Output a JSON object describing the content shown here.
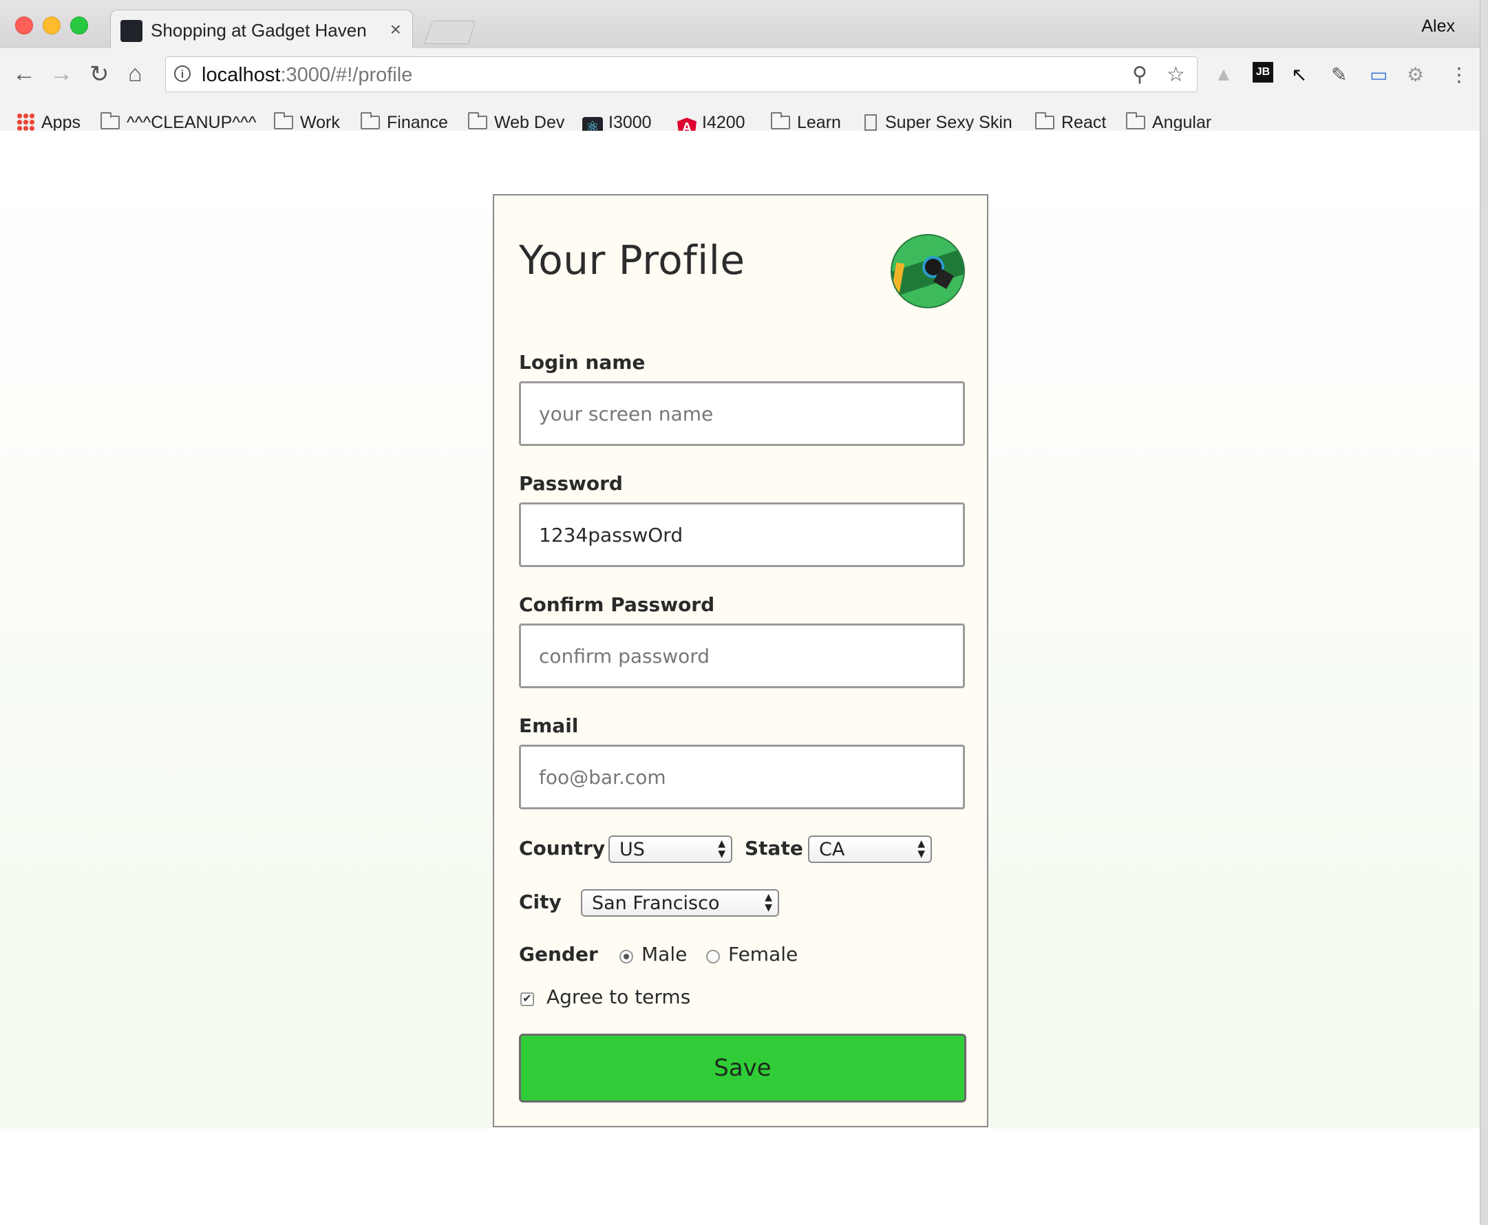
{
  "browser": {
    "tab_title": "Shopping at Gadget Haven",
    "tab_close": "×",
    "profile_name": "Alex",
    "url_host": "localhost",
    "url_rest": ":3000/#!/profile",
    "nav": {
      "back": "←",
      "forward": "→",
      "reload": "↻",
      "home": "⌂"
    },
    "icons": {
      "zoom": "⚲",
      "star": "☆",
      "drive": "▲",
      "jb": "JB",
      "cursor": "↖",
      "picker": "✎",
      "capture": "▭",
      "gear": "⚙",
      "menu": "⋮",
      "info": "i"
    },
    "bookmarks": [
      {
        "label": "Apps",
        "icon": "apps-grid-icon"
      },
      {
        "label": "^^^CLEANUP^^^",
        "icon": "folder-icon"
      },
      {
        "label": "Work",
        "icon": "folder-icon"
      },
      {
        "label": "Finance",
        "icon": "folder-icon"
      },
      {
        "label": "Web Dev",
        "icon": "folder-icon"
      },
      {
        "label": "I3000",
        "icon": "react-icon"
      },
      {
        "label": "I4200",
        "icon": "angular-icon"
      },
      {
        "label": "Learn",
        "icon": "folder-icon"
      },
      {
        "label": "Super Sexy Skin",
        "icon": "document-icon"
      },
      {
        "label": "React",
        "icon": "folder-icon"
      },
      {
        "label": "Angular",
        "icon": "folder-icon"
      }
    ],
    "glyphs": {
      "react": "⚛",
      "angular": "A"
    }
  },
  "profile": {
    "title": "Your Profile",
    "login": {
      "label": "Login name",
      "placeholder": "your screen name",
      "value": ""
    },
    "password": {
      "label": "Password",
      "placeholder": "",
      "value": "1234passwOrd"
    },
    "confirm": {
      "label": "Confirm Password",
      "placeholder": "confirm password",
      "value": ""
    },
    "email": {
      "label": "Email",
      "placeholder": "foo@bar.com",
      "value": ""
    },
    "country": {
      "label": "Country",
      "value": "US"
    },
    "state": {
      "label": "State",
      "value": "CA"
    },
    "city": {
      "label": "City",
      "value": "San Francisco"
    },
    "gender": {
      "label": "Gender",
      "options": [
        "Male",
        "Female"
      ],
      "selected": "Male"
    },
    "terms": {
      "label": "Agree to terms",
      "checked": true,
      "check_glyph": "✔"
    },
    "save_label": "Save",
    "select_arrows": "▲▼"
  },
  "colors": {
    "save_button": "#31cd38",
    "card_bg": "#fffcf4"
  }
}
